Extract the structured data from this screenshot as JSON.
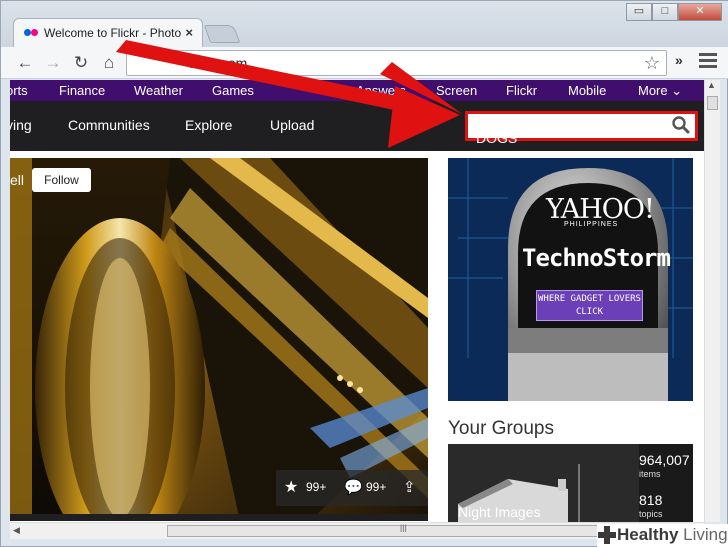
{
  "browser": {
    "tab_title": "Welcome to Flickr - Photo",
    "tab_close": "×",
    "url": "flickr.com",
    "window_controls": [
      "▭",
      "□",
      "✕"
    ],
    "toolbar_chevron": "»"
  },
  "yahoo_nav": {
    "items": [
      "orts",
      "Finance",
      "Weather",
      "Games",
      "Answers",
      "Screen",
      "Flickr",
      "Mobile",
      "More ⌄"
    ]
  },
  "flickr_nav": {
    "items": [
      "ving",
      "Communities",
      "Explore",
      "Upload"
    ],
    "search_value": "DOGS"
  },
  "hero": {
    "label": "ell",
    "follow_label": "Follow",
    "favorites": "99+",
    "comments": "99+"
  },
  "ad": {
    "brand": "YAHOO!",
    "country": "PHILIPPINES",
    "campaign": "TechnoStorm",
    "cta": "WHERE GADGET LOVERS CLICK"
  },
  "groups": {
    "title": "Your Groups",
    "card": {
      "name": "Night Images",
      "items_count": "964,007",
      "items_label": "items",
      "topics_count": "818",
      "topics_label": "topics"
    }
  },
  "scroll": {
    "grip": "lll"
  },
  "watermark": {
    "brand": "Healthy",
    "brand_suffix": "Living"
  },
  "colors": {
    "yahoo_purple": "#400f6e",
    "flickr_dark": "#1f1f21",
    "annotation_red": "#e01111"
  }
}
